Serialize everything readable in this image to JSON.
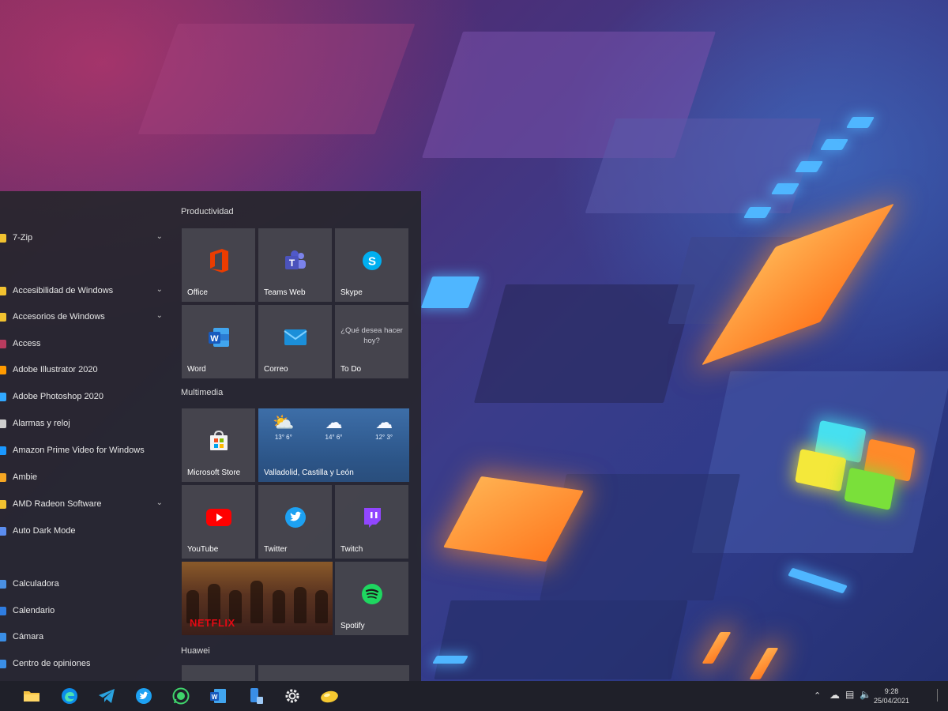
{
  "app_list": {
    "items": [
      {
        "label": "7-Zip",
        "icon": "folder-icon",
        "color": "#f2c230",
        "expandable": true
      },
      {
        "label": "Accesibilidad de Windows",
        "icon": "folder-icon",
        "color": "#f2c230",
        "expandable": true
      },
      {
        "label": "Accesorios de Windows",
        "icon": "folder-icon",
        "color": "#f2c230",
        "expandable": true
      },
      {
        "label": "Access",
        "icon": "access-icon",
        "color": "#b83b5e",
        "expandable": false
      },
      {
        "label": "Adobe Illustrator 2020",
        "icon": "illustrator-icon",
        "color": "#ff9a00",
        "expandable": false
      },
      {
        "label": "Adobe Photoshop 2020",
        "icon": "photoshop-icon",
        "color": "#31a8ff",
        "expandable": false
      },
      {
        "label": "Alarmas y reloj",
        "icon": "clock-icon",
        "color": "#cfcfcf",
        "expandable": false
      },
      {
        "label": "Amazon Prime Video for Windows",
        "icon": "prime-video-icon",
        "color": "#1a98ff",
        "expandable": false
      },
      {
        "label": "Ambie",
        "icon": "ambie-icon",
        "color": "#f5a623",
        "expandable": false
      },
      {
        "label": "AMD Radeon Software",
        "icon": "folder-icon",
        "color": "#f2c230",
        "expandable": true
      },
      {
        "label": "Auto Dark Mode",
        "icon": "auto-dark-mode-icon",
        "color": "#5b8def",
        "expandable": false
      },
      {
        "label": "Calculadora",
        "icon": "calculator-icon",
        "color": "#4a90e2",
        "expandable": false
      },
      {
        "label": "Calendario",
        "icon": "calendar-icon",
        "color": "#2f7de1",
        "expandable": false
      },
      {
        "label": "Cámara",
        "icon": "camera-icon",
        "color": "#3a8ee6",
        "expandable": false
      },
      {
        "label": "Centro de opiniones",
        "icon": "feedback-icon",
        "color": "#3a8ee6",
        "expandable": false
      }
    ]
  },
  "tiles": {
    "groups": {
      "productividad": "Productividad",
      "multimedia": "Multimedia",
      "huawei": "Huawei"
    },
    "office": "Office",
    "teams": "Teams Web",
    "skype": "Skype",
    "word": "Word",
    "correo": "Correo",
    "todo": "To Do",
    "todo_prompt": "¿Qué desea hacer hoy?",
    "store": "Microsoft Store",
    "weather_location": "Valladolid, Castilla y León",
    "weather": [
      {
        "icon": "partly-cloudy-icon",
        "temp": "13° 6°"
      },
      {
        "icon": "rain-cloud-icon",
        "temp": "14° 6°"
      },
      {
        "icon": "rain-cloud-icon",
        "temp": "12° 3°"
      }
    ],
    "youtube": "YouTube",
    "twitter": "Twitter",
    "twitch": "Twitch",
    "netflix": "NETFLIX",
    "spotify": "Spotify"
  },
  "taskbar": {
    "apps": [
      "file-explorer-icon",
      "edge-icon",
      "telegram-icon",
      "twitter-icon",
      "whatsapp-icon",
      "word-icon",
      "phone-icon",
      "settings-icon",
      "notes-icon"
    ],
    "time": "9:28",
    "date": "25/04/2021"
  },
  "colors": {
    "start_bg": "#26262c",
    "tile_bg": "#4a4a52",
    "taskbar_bg": "#1f2029"
  }
}
